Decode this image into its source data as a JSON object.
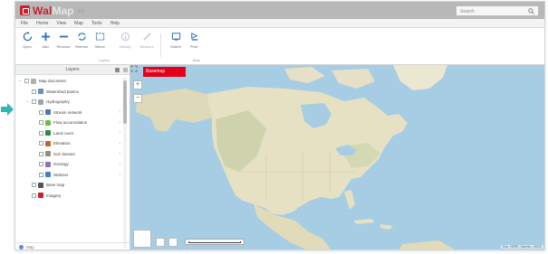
{
  "app": {
    "brand_prefix": "Wal",
    "brand_suffix": "Map",
    "version": "3.0",
    "search_placeholder": "Search",
    "accent_color": "#c9202f"
  },
  "menu": [
    "File",
    "Home",
    "View",
    "Map",
    "Tools",
    "Help"
  ],
  "ribbon": {
    "tools": [
      {
        "label": "Open",
        "icon": "refresh-icon"
      },
      {
        "label": "Add",
        "icon": "plus-icon"
      },
      {
        "label": "Remove",
        "icon": "minus-icon"
      },
      {
        "label": "Refresh",
        "icon": "sync-icon"
      },
      {
        "label": "Select",
        "icon": "select-icon"
      },
      {
        "label": "Identify",
        "icon": "info-icon"
      },
      {
        "label": "Measure",
        "icon": "ruler-icon"
      },
      {
        "label": "Extent",
        "icon": "extent-icon"
      },
      {
        "label": "Print",
        "icon": "print-icon"
      }
    ],
    "groups": [
      "Layers",
      "Map"
    ]
  },
  "panel": {
    "title": "Layers",
    "footer": "Map",
    "items": [
      {
        "label": "Map document",
        "indent": 0,
        "color": "#b0b0b0",
        "toggle": "−"
      },
      {
        "label": "Watershed basins",
        "indent": 1,
        "color": "#6c8ebf",
        "toggle": ""
      },
      {
        "label": "Hydrography",
        "indent": 1,
        "color": "#9aa5ad",
        "toggle": "−"
      },
      {
        "label": "Stream network",
        "indent": 2,
        "color": "#4a78b5",
        "toggle": ""
      },
      {
        "label": "Flow accumulation",
        "indent": 2,
        "color": "#6bbf3a",
        "toggle": ""
      },
      {
        "label": "Land cover",
        "indent": 2,
        "color": "#2d8a4e",
        "toggle": ""
      },
      {
        "label": "Elevation",
        "indent": 2,
        "color": "#c1662b",
        "toggle": ""
      },
      {
        "label": "Soil classes",
        "indent": 2,
        "color": "#9b8b73",
        "toggle": ""
      },
      {
        "label": "Geology",
        "indent": 2,
        "color": "#8f70b2",
        "toggle": ""
      },
      {
        "label": "Stations",
        "indent": 2,
        "color": "#3b83c7",
        "toggle": ""
      },
      {
        "label": "Base map",
        "indent": 1,
        "color": "#555555",
        "toggle": ""
      },
      {
        "label": "Imagery",
        "indent": 1,
        "color": "#c9202f",
        "toggle": ""
      }
    ]
  },
  "map": {
    "active_tab": "Basemap",
    "attribution": "Esri, HERE, Garmin, USGS",
    "ocean_color": "#a6cde3",
    "land_color": "#e7e1c4"
  }
}
